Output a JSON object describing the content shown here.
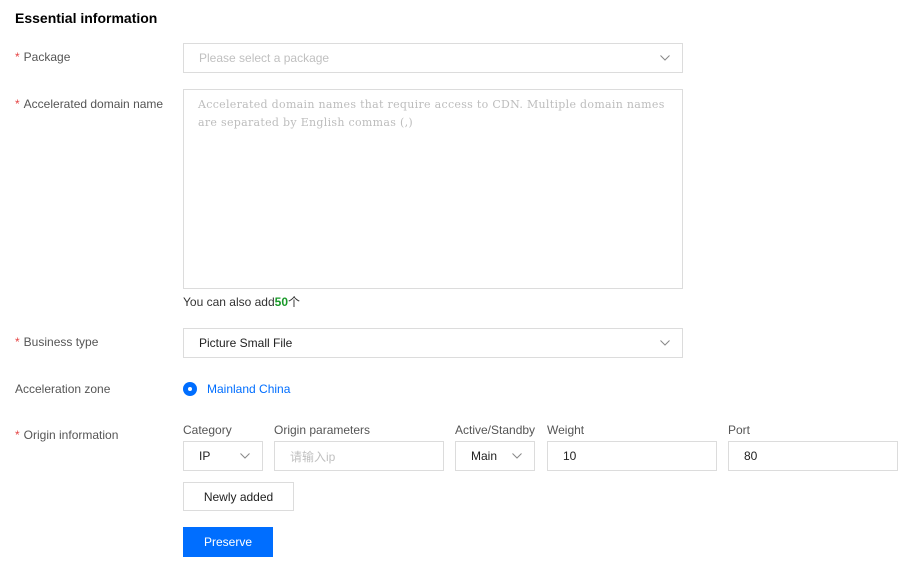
{
  "section_title": "Essential information",
  "required_mark": "*",
  "package": {
    "label": "Package",
    "placeholder": "Please select a package"
  },
  "domain": {
    "label": "Accelerated domain name",
    "placeholder": "Accelerated domain names that require access to CDN. Multiple domain names are separated by English commas (,)",
    "hint_prefix": "You can also add",
    "hint_count": "50",
    "hint_suffix": "个"
  },
  "business_type": {
    "label": "Business type",
    "value": "Picture Small File"
  },
  "acceleration_zone": {
    "label": "Acceleration zone",
    "option": "Mainland China"
  },
  "origin": {
    "label": "Origin information",
    "headers": {
      "category": "Category",
      "params": "Origin parameters",
      "active": "Active/Standby",
      "weight": "Weight",
      "port": "Port"
    },
    "category_value": "IP",
    "params_placeholder": "请输入ip",
    "active_value": "Main",
    "weight_value": "10",
    "port_value": "80"
  },
  "buttons": {
    "add": "Newly added",
    "save": "Preserve"
  },
  "colors": {
    "accent": "#006eff",
    "required": "#e54545",
    "count": "#1a9a2a"
  }
}
